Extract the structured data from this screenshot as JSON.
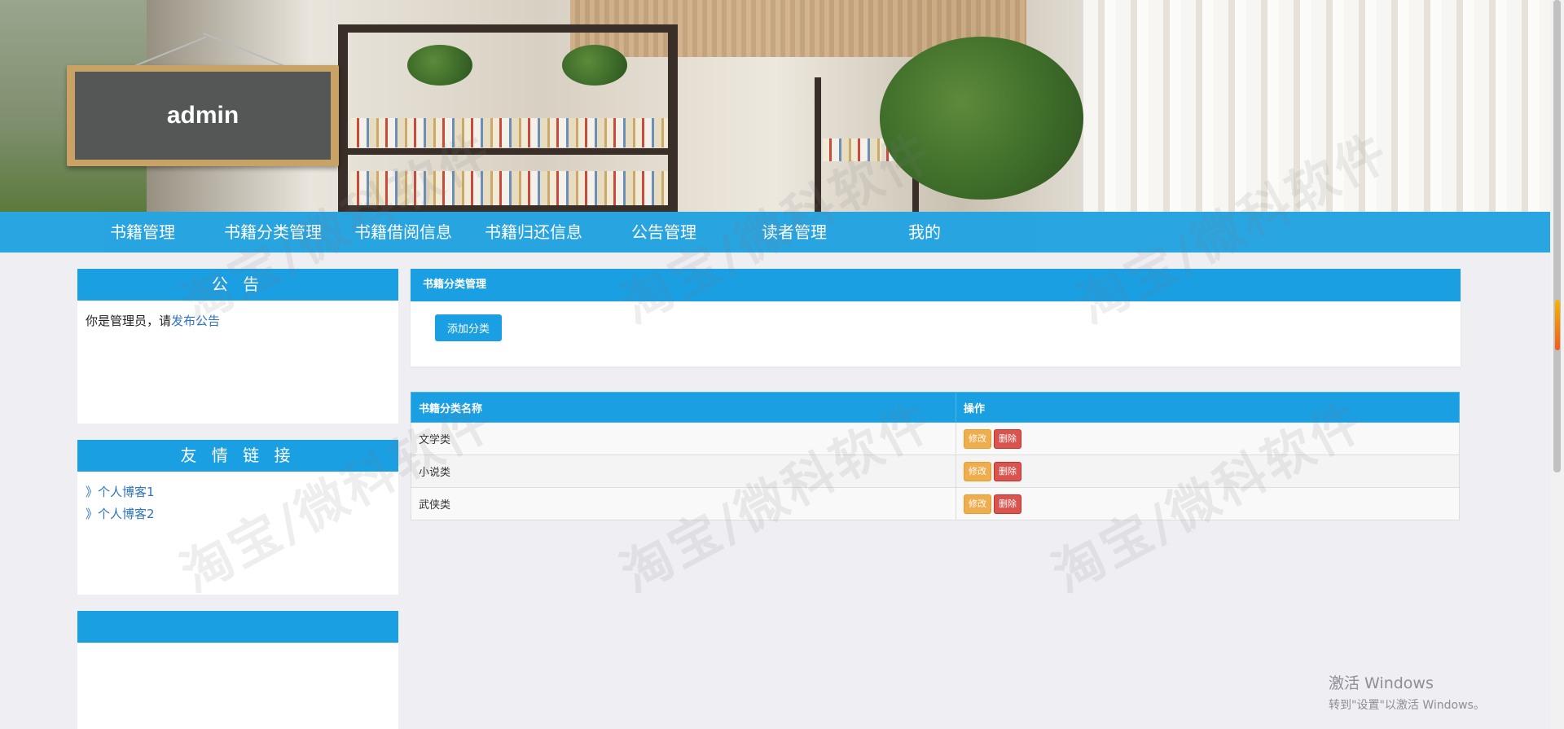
{
  "banner": {
    "user": "admin"
  },
  "nav": {
    "items": [
      "书籍管理",
      "书籍分类管理",
      "书籍借阅信息",
      "书籍归还信息",
      "公告管理",
      "读者管理",
      "我的"
    ]
  },
  "sidebar": {
    "notice": {
      "title": "公 告",
      "text": "你是管理员，请",
      "link": "发布公告"
    },
    "links": {
      "title": "友 情 链 接",
      "items": [
        "》个人博客1",
        "》个人博客2"
      ]
    }
  },
  "main": {
    "title": "书籍分类管理",
    "add_label": "添加分类",
    "table": {
      "headers": [
        "书籍分类名称",
        "操作"
      ],
      "rows": [
        "文学类",
        "小说类",
        "武侠类"
      ],
      "edit_label": "修改",
      "delete_label": "删除"
    }
  },
  "watermark": "淘宝/微科软件",
  "windows": {
    "line1": "激活 Windows",
    "line2": "转到\"设置\"以激活 Windows。"
  }
}
